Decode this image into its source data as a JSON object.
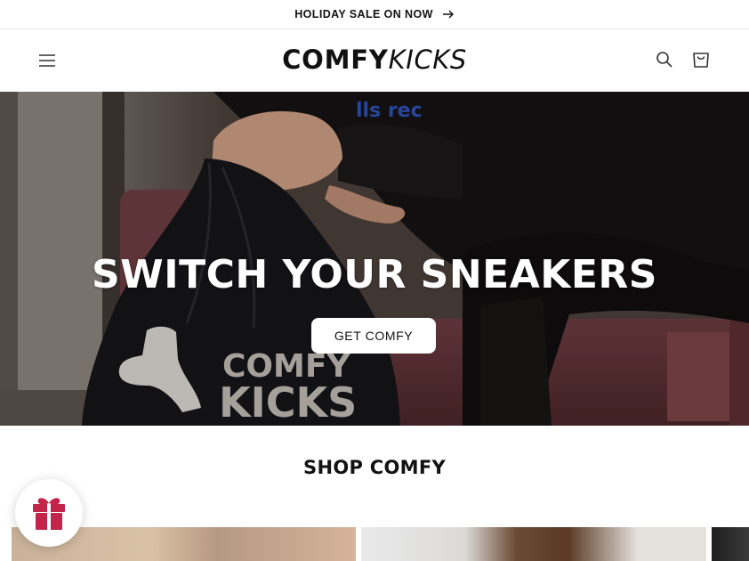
{
  "announcement": {
    "text": "HOLIDAY SALE ON NOW",
    "icon": "arrow-right-icon"
  },
  "header": {
    "logo_bold": "COMFY",
    "logo_italic": "KICKS",
    "icons": [
      "menu-icon",
      "search-icon",
      "cart-icon"
    ]
  },
  "hero": {
    "title": "SWITCH YOUR SNEAKERS",
    "button_label": "GET COMFY",
    "bag_text_line1": "COMFY",
    "bag_text_line2": "KICKS"
  },
  "collection": {
    "title": "SHOP COMFY"
  },
  "gift_widget": {
    "icon": "gift-icon",
    "color": "#c2244a"
  },
  "colors": {
    "text": "#121212",
    "background": "#ffffff",
    "accent": "#c2244a"
  }
}
